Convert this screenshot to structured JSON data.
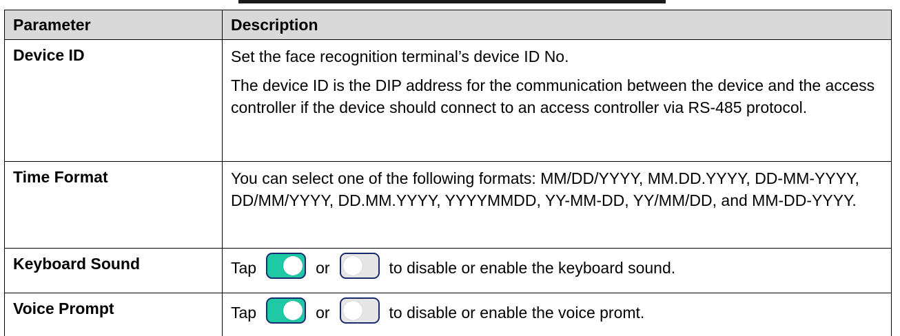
{
  "header": {
    "parameter": "Parameter",
    "description": "Description"
  },
  "rows": {
    "device_id": {
      "name": "Device ID",
      "line1": "Set the face recognition terminal’s device ID No.",
      "line2": "The device ID is the DIP address for the communication between the device and the access controller if the device should connect to an access controller via RS-485 protocol."
    },
    "time_format": {
      "name": "Time Format",
      "text": "You can select one of the following formats: MM/DD/YYYY, MM.DD.YYYY, DD-MM-YYYY, DD/MM/YYYY, DD.MM.YYYY, YYYYMMDD, YY-MM-DD, YY/MM/DD, and MM-DD-YYYY."
    },
    "keyboard_sound": {
      "name": "Keyboard Sound",
      "tap": "Tap",
      "or": "or",
      "rest": "to disable or enable the keyboard sound."
    },
    "voice_prompt": {
      "name": "Voice Prompt",
      "tap": "Tap",
      "or": "or",
      "rest": "to disable or enable the voice promt."
    }
  },
  "colors": {
    "header_bg": "#d9d9d9",
    "toggle_on": "#1fc9a6",
    "toggle_off": "#e6e6e6",
    "toggle_border": "#1a2b6d"
  },
  "icons": {
    "toggle_on": "toggle-on-icon",
    "toggle_off": "toggle-off-icon"
  }
}
